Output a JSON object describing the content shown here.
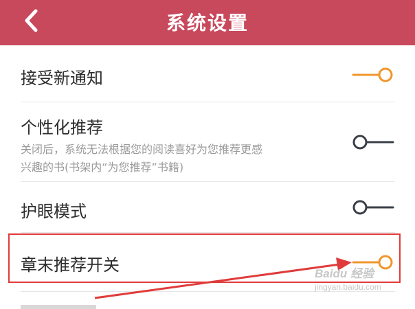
{
  "header": {
    "title": "系统设置",
    "back_icon": "chevron-left-icon",
    "color": "#c8485c"
  },
  "settings": [
    {
      "label": "接受新通知",
      "enabled": true
    },
    {
      "label": "个性化推荐",
      "description_line1": "关闭后，系统无法根据您的阅读喜好为您推荐更感",
      "description_line2": "兴趣的书(书架内“为您推荐”书籍)",
      "enabled": false
    },
    {
      "label": "护眼模式",
      "enabled": false
    },
    {
      "label": "章末推荐开关",
      "enabled": true
    }
  ],
  "toggle_colors": {
    "on": "#f0962d",
    "off": "#3a3f47"
  },
  "annotation": {
    "highlight_color": "#e03b3b",
    "highlighted_item": "章末推荐开关"
  },
  "watermark": {
    "brand": "Baidu 经验",
    "url": "jingyan.baidu.com"
  }
}
